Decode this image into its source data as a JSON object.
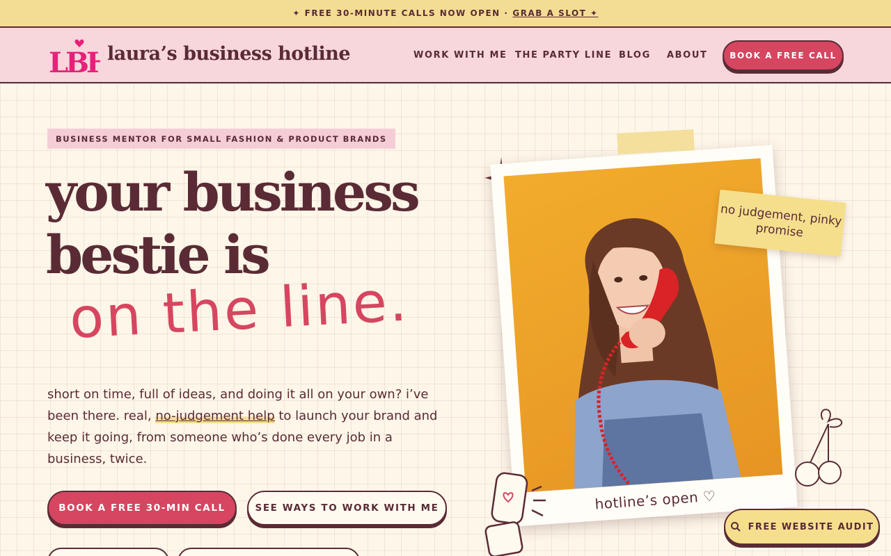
{
  "announcement": {
    "text": "✦ FREE 30-MINUTE CALLS NOW OPEN ·",
    "link": "GRAB A SLOT ✦"
  },
  "header": {
    "logo_mark": "LBH",
    "brand": "laura’s business hotline",
    "nav": [
      "WORK WITH ME",
      "THE PARTY LINE",
      "BLOG",
      "ABOUT"
    ],
    "cta": "BOOK A FREE CALL"
  },
  "hero": {
    "eyebrow": "BUSINESS MENTOR FOR SMALL FASHION & PRODUCT BRANDS",
    "headline_line1": "your business",
    "headline_line2": "bestie is",
    "headline_script": "on the line.",
    "body_part1": "short on time, full of ideas, and doing it all on your own? i’ve been there. real, ",
    "body_highlight": "no-judgement help",
    "body_part2": " to launch your brand and keep it going, from someone who’s done every job in a business, twice.",
    "cta_primary": "BOOK A FREE 30-MIN CALL",
    "cta_secondary": "SEE WAYS TO WORK WITH ME"
  },
  "photo": {
    "caption": "hotline’s open ♡",
    "sticky_note": "no judgement, pinky promise"
  },
  "floating_button": {
    "label": "FREE WEBSITE AUDIT",
    "icon": "search-icon"
  },
  "colors": {
    "accent": "#d64660",
    "ink": "#5a2b35",
    "cream": "#fdf6e9",
    "pink": "#f7d6dc",
    "butter": "#f3dd94"
  }
}
